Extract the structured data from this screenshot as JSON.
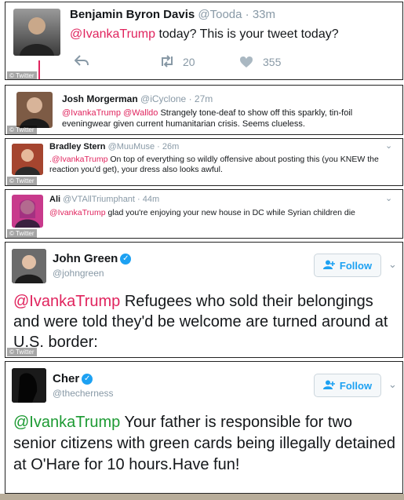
{
  "watermark": "© Twitter",
  "tweets": [
    {
      "name": "Benjamin Byron Davis",
      "handle": "@Tooda",
      "dot": "·",
      "time": "33m",
      "mention": "@IvankaTrump",
      "text": " today? This is your tweet today?",
      "retweets": "20",
      "likes": "355"
    },
    {
      "name": "Josh Morgerman",
      "handle": "@iCyclone",
      "dot": "·",
      "time": "27m",
      "mention": "@IvankaTrump @Walldo",
      "text": " Strangely tone-deaf to show off this sparkly, tin-foil eveningwear given current humanitarian crisis. Seems clueless."
    },
    {
      "name": "Bradley Stern",
      "handle": "@MuuMuse",
      "dot": "·",
      "time": "26m",
      "mention": ".@IvankaTrump",
      "text": " On top of everything so wildly offensive about posting this (you KNEW the reaction you'd get), your dress also looks awful."
    },
    {
      "name": "Ali",
      "handle": "@VTAllTriumphant",
      "dot": "·",
      "time": "44m",
      "mention": "@IvankaTrump",
      "text": " glad you're enjoying your new house in DC while Syrian children die"
    },
    {
      "name": "John Green",
      "handle": "@johngreen",
      "follow": "Follow",
      "mention": "@IvankaTrump",
      "text": " Refugees who sold their belongings and were told they'd be welcome are turned around at U.S. border:"
    },
    {
      "name": "Cher",
      "handle": "@thecherness",
      "follow": "Follow",
      "mention": "@IvankaTrump",
      "text": " Your father is responsible for two senior citizens with green cards being illegally detained at O'Hare for 10 hours.Have fun!"
    }
  ],
  "colors": {
    "mention_pink": "#e0245e",
    "mention_green": "#1d9a33",
    "twitter_blue": "#1da1f2",
    "muted": "#8899a6"
  }
}
